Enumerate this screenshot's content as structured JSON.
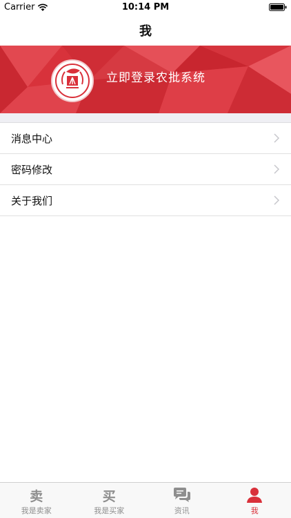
{
  "status_bar": {
    "carrier": "Carrier",
    "time": "10:14 PM"
  },
  "nav": {
    "title": "我"
  },
  "banner": {
    "login_text": "立即登录农批系统",
    "accent_color": "#d9303a"
  },
  "menu": {
    "items": [
      {
        "label": "消息中心"
      },
      {
        "label": "密码修改"
      },
      {
        "label": "关于我们"
      }
    ]
  },
  "tabbar": {
    "tabs": [
      {
        "icon_glyph": "卖",
        "icon": "sell-icon",
        "label": "我是卖家",
        "active": false
      },
      {
        "icon_glyph": "买",
        "icon": "buy-icon",
        "label": "我是买家",
        "active": false
      },
      {
        "icon": "chat-bubbles-icon",
        "label": "资讯",
        "active": false
      },
      {
        "icon": "person-icon",
        "label": "我",
        "active": true
      }
    ],
    "active_color": "#d9303a",
    "inactive_color": "#8e8e8e"
  }
}
